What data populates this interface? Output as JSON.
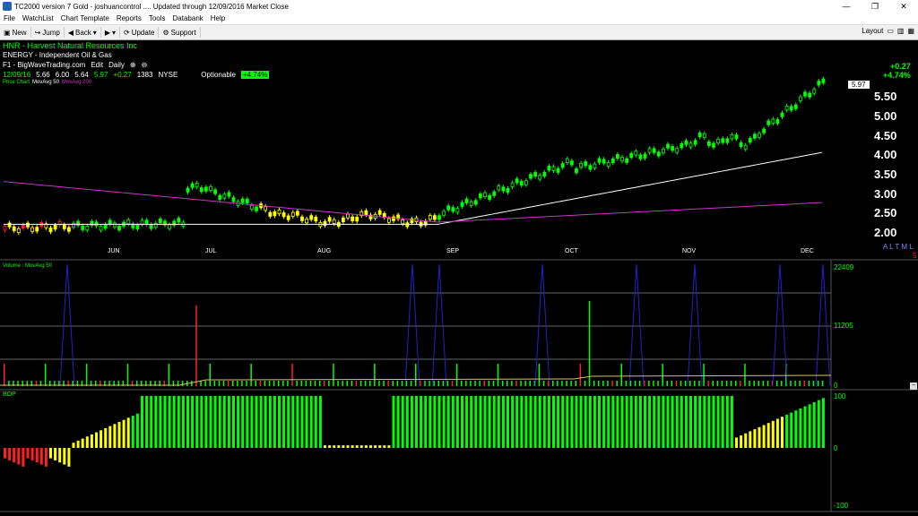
{
  "window": {
    "title": "TC2000 version 7 Gold - joshuancontrol  .... Updated through 12/09/2016  Market Close",
    "min": "—",
    "max": "❐",
    "close": "✕"
  },
  "menu": [
    "File",
    "WatchList",
    "Chart Template",
    "Reports",
    "Tools",
    "Databank",
    "Help"
  ],
  "toolbar": {
    "new": "New",
    "jump": "Jump",
    "back": "Back",
    "update": "Update",
    "support": "Support",
    "layout": "Layout"
  },
  "header": {
    "symbol": "HNR - Harvest Natural Resources Inc",
    "sector": "ENERGY - Independent Oil & Gas",
    "watchlist": "F1 - BigWaveTrading.com",
    "edit": "Edit",
    "interval": "Daily",
    "date": "12/09/16",
    "open": "5.66",
    "high": "6.00",
    "low": "5.64",
    "close": "5.97",
    "chg": "+0.27",
    "volume": "1383",
    "exchange": "NYSE",
    "optionable": "Optionable",
    "pct_badge": "+4.74%",
    "right_chg": "+0.27",
    "right_pct": "+4.74%",
    "indicators": [
      "Price Chart",
      "MovAvg 50",
      "MovAvg 200"
    ],
    "last_price": "5.97"
  },
  "price_axis": [
    "5.50",
    "5.00",
    "4.50",
    "4.00",
    "3.50",
    "3.00",
    "2.50",
    "2.00"
  ],
  "months": [
    "JUN",
    "JUL",
    "AUG",
    "SEP",
    "OCT",
    "NOV",
    "DEC"
  ],
  "alerts": "A L T M L",
  "alert_red": "5",
  "volume_panel": {
    "label": "Volume : MovAvg 50",
    "axis": [
      "22409",
      "11205",
      "0"
    ]
  },
  "bop_panel": {
    "label": "BOP",
    "axis": [
      "100",
      "0",
      "-100"
    ]
  },
  "colors": {
    "up": "#00ff00",
    "down": "#00ff00",
    "neutral": "#ffff00",
    "red": "#ff2020",
    "ma50": "#ffffff",
    "ma200": "#cc33cc",
    "volma": "#d4c36a",
    "spikes": "#2222cc"
  }
}
